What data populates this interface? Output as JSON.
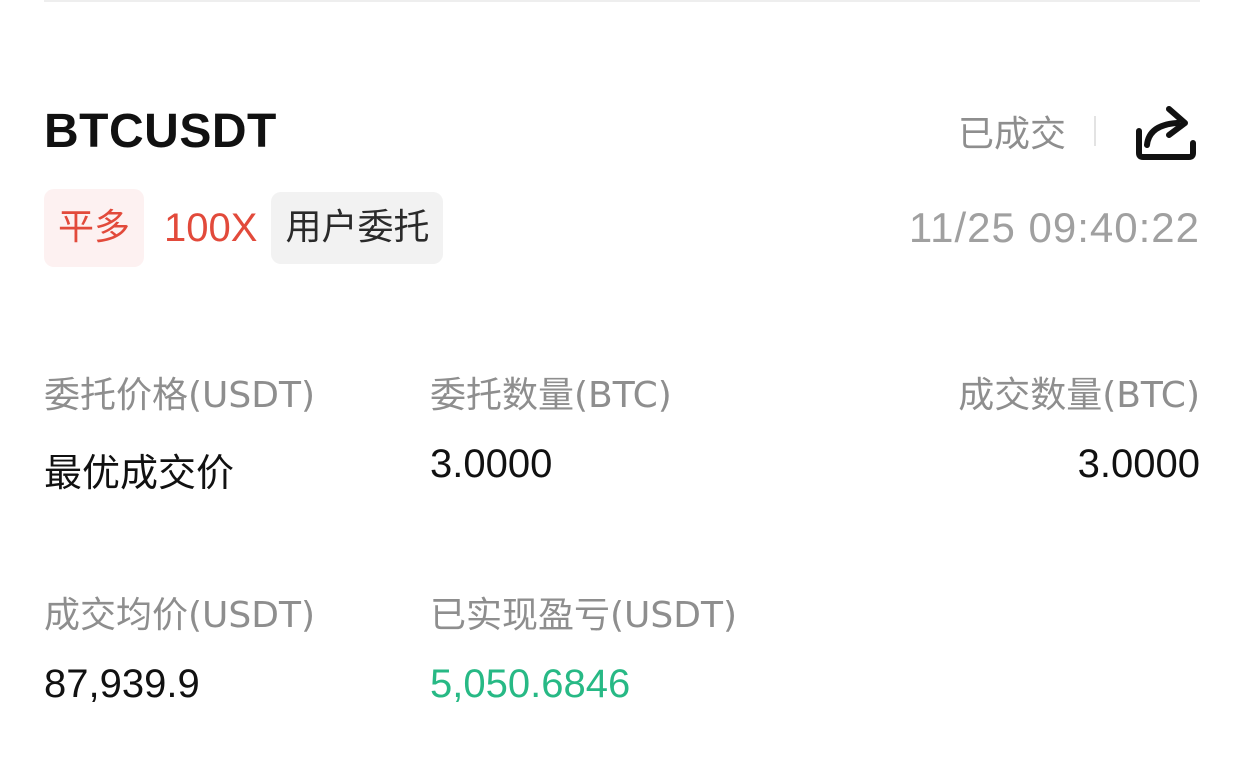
{
  "order": {
    "symbol": "BTCUSDT",
    "status": "已成交",
    "direction": "平多",
    "leverage": "100X",
    "source": "用户委托",
    "time": "11/25 09:40:22"
  },
  "fields": {
    "order_price_label": "委托价格(USDT)",
    "order_price_value": "最优成交价",
    "order_qty_label": "委托数量(BTC)",
    "order_qty_value": "3.0000",
    "filled_qty_label": "成交数量(BTC)",
    "filled_qty_value": "3.0000",
    "avg_price_label": "成交均价(USDT)",
    "avg_price_value": "87,939.9",
    "realized_pnl_label": "已实现盈亏(USDT)",
    "realized_pnl_value": "5,050.6846"
  },
  "icons": {
    "share": "share-icon"
  },
  "colors": {
    "sell_red": "#e24a3b",
    "profit_green": "#27b985",
    "label_gray": "#8e8e8e"
  }
}
